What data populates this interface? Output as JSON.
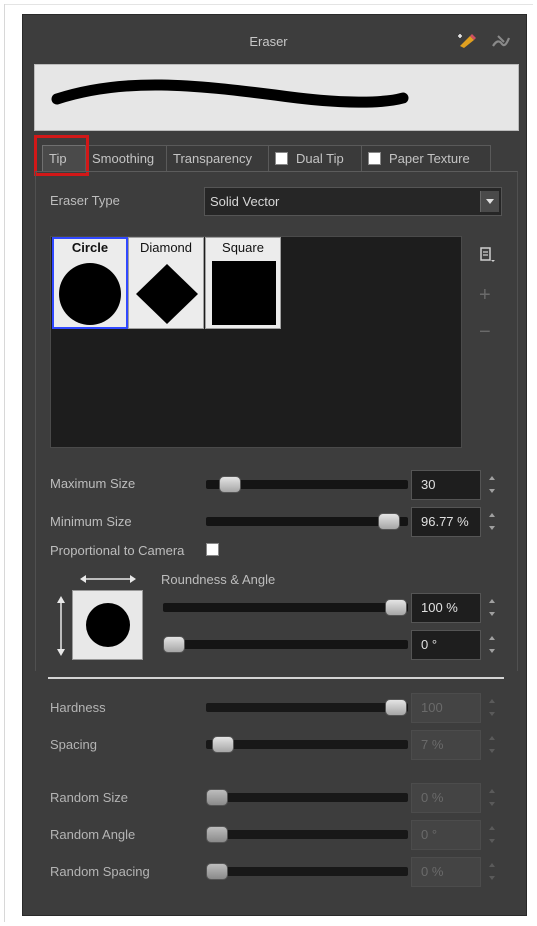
{
  "panel": {
    "title": "Eraser",
    "title_icons": [
      "eraser-pencil-icon",
      "brush-settings-icon"
    ]
  },
  "tabs": [
    {
      "label": "Tip",
      "active": true
    },
    {
      "label": "Smoothing",
      "active": false
    },
    {
      "label": "Transparency",
      "active": false
    },
    {
      "label": "Dual Tip",
      "checkbox": true,
      "checked": false
    },
    {
      "label": "Paper Texture",
      "checkbox": true,
      "checked": false
    }
  ],
  "eraser_type": {
    "label": "Eraser Type",
    "value": "Solid Vector"
  },
  "tips": [
    {
      "name": "Circle",
      "selected": true,
      "shape": "circle"
    },
    {
      "name": "Diamond",
      "selected": false,
      "shape": "diamond"
    },
    {
      "name": "Square",
      "selected": false,
      "shape": "square"
    }
  ],
  "tip_side_buttons": {
    "menu_icon": "tip-menu-icon",
    "add_icon": "plus-icon",
    "remove_icon": "minus-icon"
  },
  "settings": {
    "maximum_size": {
      "label": "Maximum Size",
      "value": "30",
      "level": 0.04
    },
    "minimum_size": {
      "label": "Minimum Size",
      "value": "96.77 %",
      "level": 0.97
    },
    "proportional_to_camera": {
      "label": "Proportional to Camera",
      "checked": false
    },
    "roundness_angle": {
      "label": "Roundness & Angle",
      "roundness_value": "100 %",
      "roundness_level": 1.0,
      "angle_value": "0 °",
      "angle_level": 0.0
    },
    "hardness": {
      "label": "Hardness",
      "value": "100",
      "level": 1.0,
      "disabled": true
    },
    "spacing": {
      "label": "Spacing",
      "value": "7 %",
      "level": 0.03,
      "disabled": true
    },
    "random_size": {
      "label": "Random Size",
      "value": "0 %",
      "level": 0.0,
      "disabled": true
    },
    "random_angle": {
      "label": "Random Angle",
      "value": "0 °",
      "level": 0.0,
      "disabled": true
    },
    "random_spacing": {
      "label": "Random Spacing",
      "value": "0 %",
      "level": 0.0,
      "disabled": true
    }
  },
  "colors": {
    "panel_bg": "#3d3d3d",
    "selection_border": "#3048ff",
    "callout_red": "#d21818"
  }
}
